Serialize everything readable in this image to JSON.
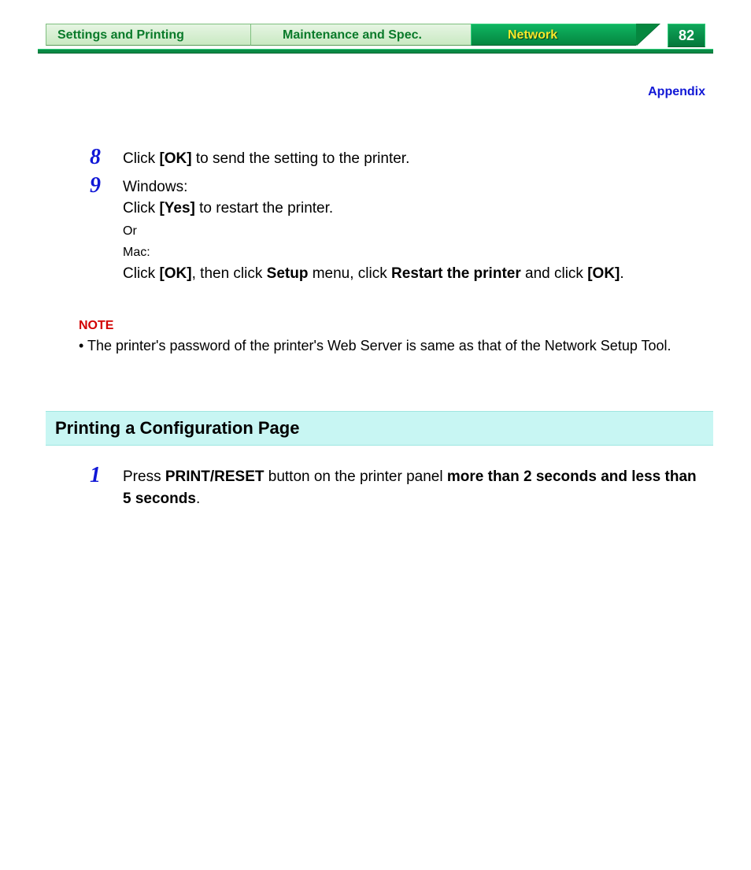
{
  "header": {
    "tabs": [
      {
        "label": "Settings and Printing"
      },
      {
        "label": "Maintenance and Spec."
      },
      {
        "label": "Network"
      }
    ],
    "page_number": "82",
    "appendix_label": "Appendix"
  },
  "steps_a": [
    {
      "num": "8",
      "html": "Click <b>[OK]</b> to send the setting to the printer."
    },
    {
      "num": "9",
      "html": "Windows:<br>Click <b>[Yes]</b> to restart the printer.<br><span class=\"small\">Or<br>Mac:</span><br>Click <b>[OK]</b>, then click <b>Setup</b> menu, click <b>Restart the printer</b> and click <b>[OK]</b>."
    }
  ],
  "note": {
    "label": "NOTE",
    "text": "The printer's password of the printer's Web Server is same as that of the Network Setup Tool."
  },
  "section": {
    "title": "Printing a Configuration Page",
    "steps": [
      {
        "num": "1",
        "html": "Press <b>PRINT/RESET</b> button on the printer panel <b>more than 2 seconds and less than 5 seconds</b>."
      }
    ]
  }
}
